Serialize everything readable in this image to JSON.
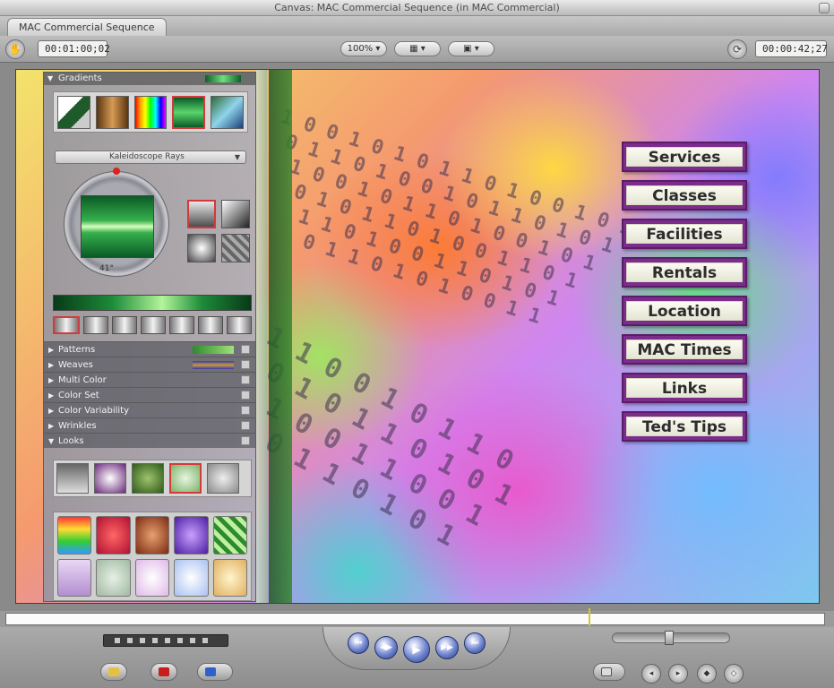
{
  "window": {
    "title": "Canvas: MAC Commercial Sequence (in MAC Commercial)"
  },
  "tabs": [
    {
      "label": "MAC Commercial Sequence"
    }
  ],
  "toolbar": {
    "current_timecode": "00:01:00;02",
    "duration_timecode": "00:00:42;27",
    "zoom_label": "100%",
    "view_label": "",
    "overlay_label": ""
  },
  "panel": {
    "gradients_header": "Gradients",
    "gradient_type": "Kaleidoscope Rays",
    "angle": "41°",
    "sections": [
      {
        "label": "Patterns",
        "expanded": false
      },
      {
        "label": "Weaves",
        "expanded": false
      },
      {
        "label": "Multi Color",
        "expanded": false
      },
      {
        "label": "Color Set",
        "expanded": false
      },
      {
        "label": "Color Variability",
        "expanded": false
      },
      {
        "label": "Wrinkles",
        "expanded": false
      },
      {
        "label": "Looks",
        "expanded": true
      }
    ]
  },
  "menu": {
    "items": [
      {
        "label": "Services"
      },
      {
        "label": "Classes"
      },
      {
        "label": "Facilities"
      },
      {
        "label": "Rentals"
      },
      {
        "label": "Location"
      },
      {
        "label": "MAC Times"
      },
      {
        "label": "Links"
      },
      {
        "label": "Ted's Tips"
      }
    ]
  },
  "colors": {
    "menu_border": "#7c2d8c",
    "menu_face": "#f6f6ea",
    "selection": "#d23b3b",
    "playhead": "#d6c832",
    "transport_button": "#4f66b8"
  },
  "icons": {
    "hand_tool": "hand-icon",
    "sync": "sync-icon",
    "play": "play-icon",
    "stop": "stop-icon"
  }
}
